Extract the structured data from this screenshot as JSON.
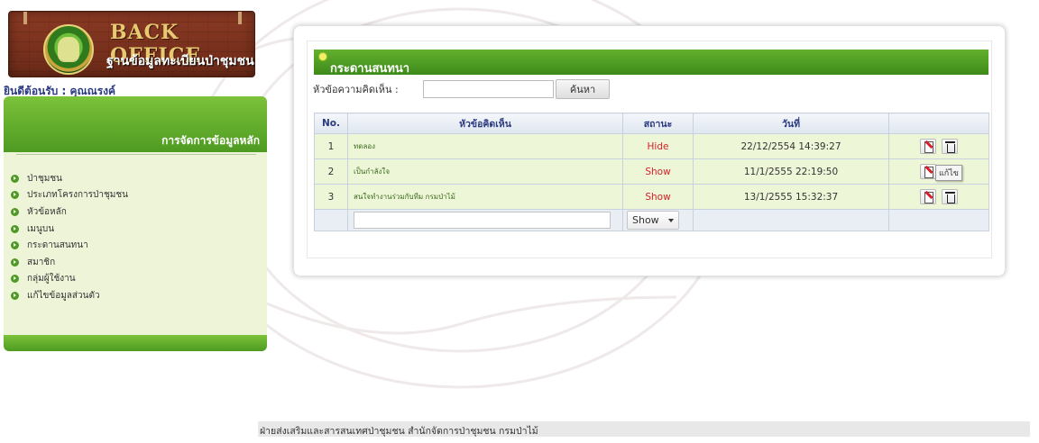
{
  "logo": {
    "title": "BACK OFFICE",
    "subtitle": "ฐานข้อมูลทะเบียนป่าชุมชน"
  },
  "welcome": "ยินดีต้อนรับ : คุณณรงค์",
  "menu": {
    "header_title": "การจัดการข้อมูลหลัก",
    "items": [
      {
        "label": "ป่าชุมชน"
      },
      {
        "label": "ประเภทโครงการป่าชุมชน"
      },
      {
        "label": "หัวข้อหลัก"
      },
      {
        "label": "เมนูบน"
      },
      {
        "label": "กระดานสนทนา"
      },
      {
        "label": "สมาชิก"
      },
      {
        "label": "กลุ่มผู้ใช้งาน"
      },
      {
        "label": "แก้ไขข้อมูลส่วนตัว"
      }
    ],
    "bullet_color": "#4e9a22"
  },
  "board": {
    "title": "กระดานสนทนา",
    "search_label": "หัวข้อความคิดเห็น :",
    "search_value": "",
    "search_button": "ค้นหา",
    "columns": {
      "no": "No.",
      "topic": "หัวข้อคิดเห็น",
      "status": "สถานะ",
      "date": "วันที่",
      "actions": ""
    },
    "rows": [
      {
        "no": "1",
        "topic": "ทดลอง",
        "status": "Hide",
        "date": "22/12/2554 14:39:27"
      },
      {
        "no": "2",
        "topic": "เป็นกำลังใจ",
        "status": "Show",
        "date": "11/1/2555 22:19:50"
      },
      {
        "no": "3",
        "topic": "สนใจทำงานร่วมกับทีม กรมป่าไม้",
        "status": "Show",
        "date": "13/1/2555 15:32:37"
      }
    ],
    "edit_tooltip": "แก้ไข",
    "filter": {
      "topic_value": "",
      "status_selected": "Show"
    },
    "header_color": "#3e8a1a",
    "status_color": "#d4202a"
  },
  "footer": "ฝ่ายส่งเสริมและสารสนเทศป่าชุมชน สำนักจัดการป่าชุมชน กรมป่าไม้"
}
